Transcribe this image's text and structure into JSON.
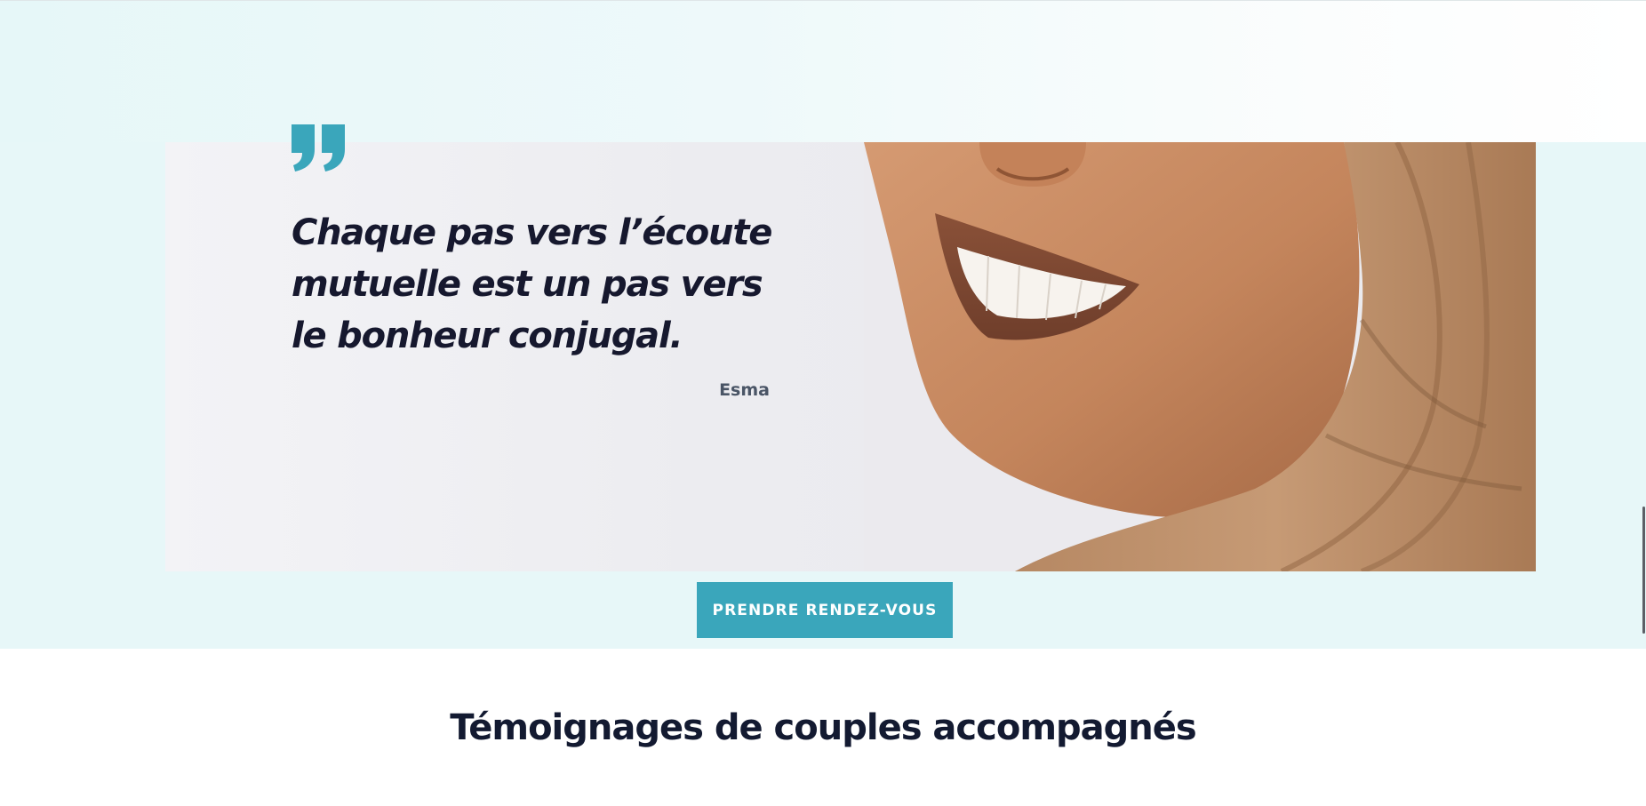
{
  "testimonial": {
    "quote_icon": "closing-quote-icon",
    "quote": "Chaque pas vers l’écoute mutuelle est un pas vers le bonheur conjugal.",
    "author": "Esma",
    "photo_description_icon": "smiling-woman-photo"
  },
  "cta": {
    "label": "PRENDRE RENDEZ-VOUS"
  },
  "testimonials_section": {
    "title": "Témoignages de couples accompagnés"
  },
  "colors": {
    "accent": "#3aa6bb",
    "hero_background": "#e7f7f8",
    "heading_text": "#131a31"
  }
}
